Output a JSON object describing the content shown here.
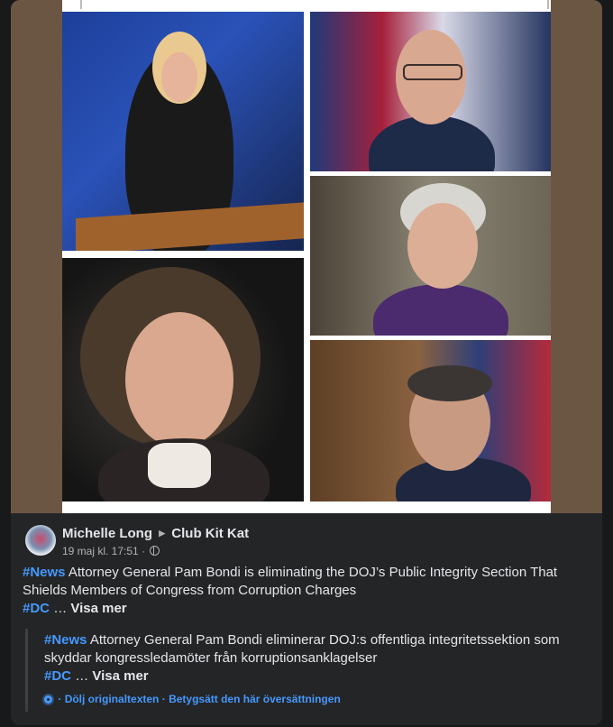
{
  "post": {
    "author": "Michelle Long",
    "group": "Club Kit Kat",
    "timestamp": "19 maj kl. 17:51",
    "visibility_icon": "globe-icon",
    "separator": "·",
    "hashtag_news": "#News",
    "body": "Attorney General Pam Bondi is eliminating the DOJ’s Public Integrity Section That Shields Members of Congress from Corruption Charges",
    "hashtag_dc": "#DC",
    "ellipsis": "…",
    "see_more": "Visa mer"
  },
  "translation": {
    "hashtag_news": "#News",
    "body": "Attorney General Pam Bondi eliminerar DOJ:s offentliga integritetssektion som skyddar kongressledamöter från korruptionsanklagelser",
    "hashtag_dc": "#DC",
    "ellipsis": "…",
    "see_more": "Visa mer",
    "settings_icon": "gear-icon",
    "hide_original": "Dölj originaltexten",
    "rate_translation": "Betygsätt den här översättningen",
    "separator": "·"
  },
  "colors": {
    "link": "#4599ff",
    "card": "#242526",
    "media_bg": "#6b5644"
  }
}
